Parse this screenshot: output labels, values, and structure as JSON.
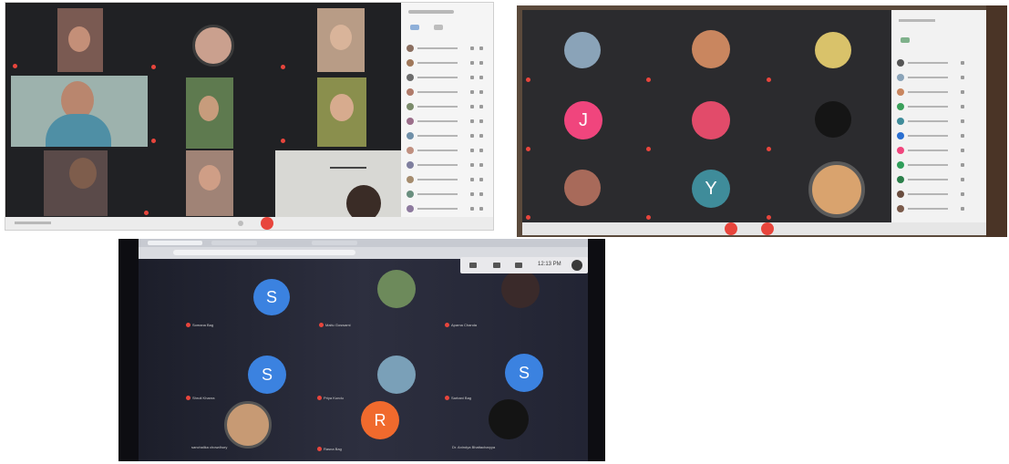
{
  "photo3": {
    "clock": "12:13 PM",
    "tiles": [
      {
        "initial": "S",
        "name": "Somana Bag"
      },
      {
        "initial": "",
        "name": "Maitu Goswami"
      },
      {
        "initial": "",
        "name": "Aparna Chanda"
      },
      {
        "initial": "S",
        "name": "Shruti Khanra"
      },
      {
        "initial": "",
        "name": "Priya Kundu"
      },
      {
        "initial": "S",
        "name": "Sarbani Bag"
      },
      {
        "initial": "",
        "name": "sanchalika chowdhury"
      },
      {
        "initial": "R",
        "name": "Rasna Bag"
      },
      {
        "initial": "",
        "name": "Dr. Anindya Bhattacharyya"
      }
    ]
  },
  "photo2": {
    "tiles": [
      {
        "initial": ""
      },
      {
        "initial": ""
      },
      {
        "initial": ""
      },
      {
        "initial": "J"
      },
      {
        "initial": ""
      },
      {
        "initial": ""
      },
      {
        "initial": ""
      },
      {
        "initial": "Y"
      },
      {
        "initial": ""
      }
    ]
  },
  "colors": {
    "meet_dark": "#202124",
    "end_call_red": "#e8453c",
    "avatar_blue": "#3b82e0",
    "avatar_pink": "#f0457d",
    "avatar_teal": "#3f8c9a",
    "avatar_orange": "#f06a2d"
  }
}
